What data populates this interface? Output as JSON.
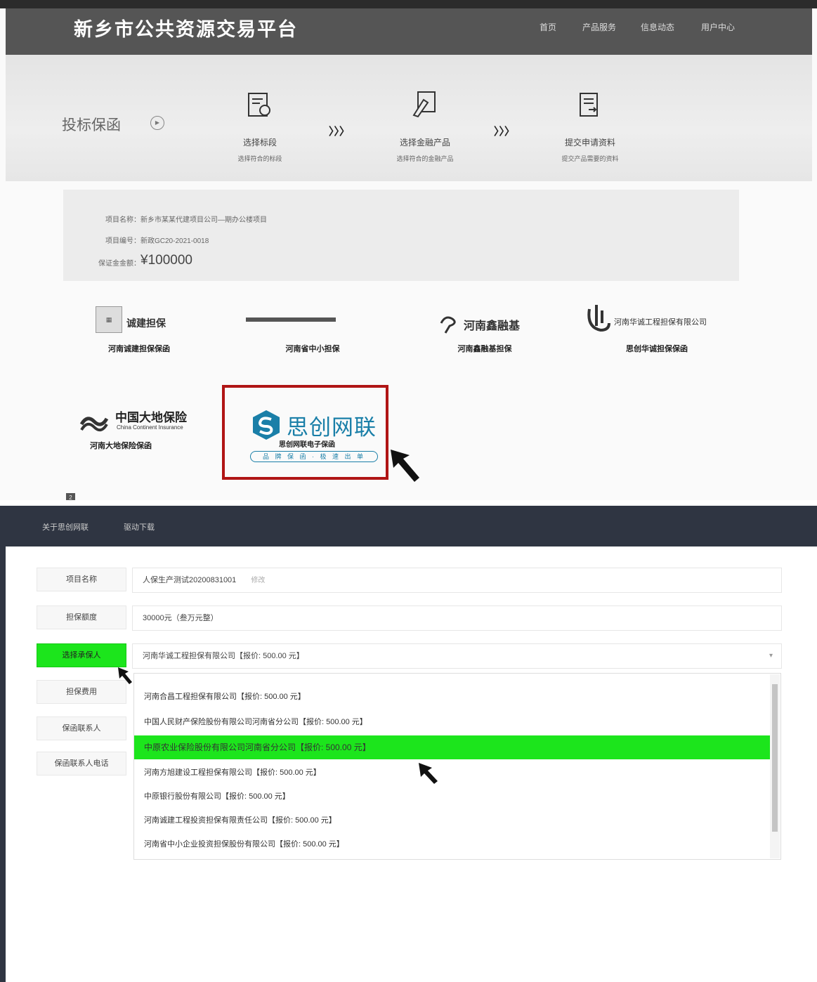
{
  "site": {
    "title": "新乡市公共资源交易平台",
    "nav": [
      "首页",
      "产品服务",
      "信息动态",
      "用户中心"
    ]
  },
  "hero": {
    "title": "投标保函",
    "arrows": "〉〉〉",
    "steps": [
      {
        "title": "选择标段",
        "sub": "选择符合的标段"
      },
      {
        "title": "选择金融产品",
        "sub": "选择符合的金融产品"
      },
      {
        "title": "提交申请资料",
        "sub": "提交产品需要的资料"
      }
    ]
  },
  "project_info": {
    "name_line": "项目名称：新乡市某某代建项目公司—期办公楼项目",
    "code_line": "项目编号：新政GC20-2021-0018",
    "amount_label": "保证金金额：",
    "amount_value": "¥100000"
  },
  "providers": [
    {
      "logo_text": "诚建担保",
      "name": "河南诚建担保保函"
    },
    {
      "logo_text": "",
      "name": "河南省中小担保"
    },
    {
      "logo_text": "河南鑫融基",
      "name": "河南鑫融基担保"
    },
    {
      "logo_text": "河南华诚工程担保有限公司",
      "name": "思创华诚担保保函"
    },
    {
      "logo_text": "中国大地保险",
      "logo_sub": "China Continent Insurance",
      "name": "河南大地保险保函"
    },
    {
      "logo_text": "思创网联",
      "name": "思创网联电子保函",
      "tagline": "品 牌 保 函 · 极 速 出 单"
    }
  ],
  "page_marker": "2",
  "bottom_nav": [
    "关于思创网联",
    "驱动下载"
  ],
  "form": {
    "rows": [
      {
        "label": "项目名称",
        "value": "人保生产测试20200831001",
        "extra": "修改"
      },
      {
        "label": "担保额度",
        "value": "30000元（叁万元整）"
      },
      {
        "label": "选择承保人",
        "value": "河南华诚工程担保有限公司【报价: 500.00 元】"
      },
      {
        "label": "担保费用",
        "value": ""
      },
      {
        "label": "保函联系人",
        "value": ""
      },
      {
        "label": "保函联系人电话",
        "value": ""
      }
    ],
    "dropdown_indicator": "▾"
  },
  "dropdown_options": [
    "河南合昌工程担保有限公司【报价: 500.00 元】",
    "中国人民财产保险股份有限公司河南省分公司【报价: 500.00 元】",
    "中原农业保险股份有限公司河南省分公司【报价: 500.00 元】",
    "河南方旭建设工程担保有限公司【报价: 500.00 元】",
    "中原银行股份有限公司【报价: 500.00 元】",
    "河南诚建工程投资担保有限责任公司【报价: 500.00 元】",
    "河南省中小企业投资担保股份有限公司【报价: 500.00 元】"
  ],
  "highlighted_option_index": 2,
  "colors": {
    "highlight_green": "#1ce51c",
    "selection_border_red": "#b01515",
    "header_dark": "#555555",
    "bottom_nav_dark": "#2f3542",
    "brand_blue": "#1a7fa8"
  }
}
